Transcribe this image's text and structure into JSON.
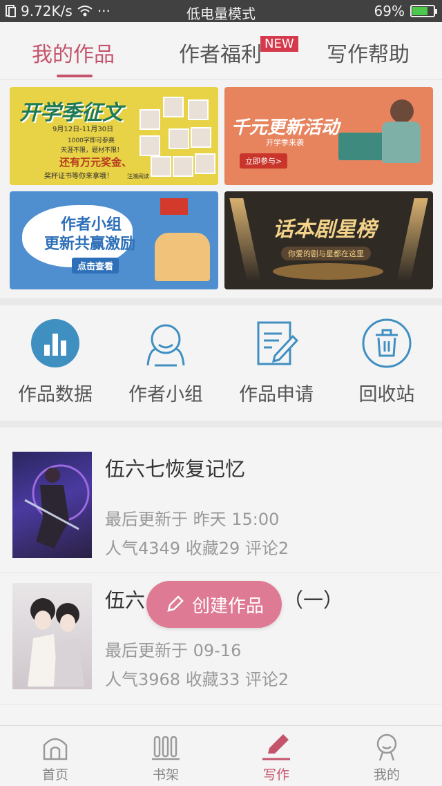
{
  "status_bar": {
    "network_speed": "9.72K/s",
    "more": "···",
    "mode": "低电量模式",
    "battery": "69%",
    "battery_level": 0.69
  },
  "tabs": [
    {
      "label": "我的作品",
      "active": true
    },
    {
      "label": "作者福利",
      "badge": "NEW"
    },
    {
      "label": "写作帮助"
    }
  ],
  "banners": [
    {
      "title": "开学季征文",
      "dates": "9月12日-11月30日",
      "line1": "1000字即可参赛",
      "line2": "天涯不限，题材不限！",
      "line3": "还有万元奖金、",
      "line4": "奖杯证书等你来拿哦！",
      "brand": "汪潮阅读"
    },
    {
      "title": "千元更新活动",
      "subtitle": "开学季来袭",
      "cta": "立即参与>"
    },
    {
      "title1": "作者小组",
      "title2": "更新共赢激励",
      "cta": "点击查看"
    },
    {
      "title": "话本剧星榜",
      "subtitle": "你爱的剧与星都在这里"
    }
  ],
  "quick_actions": [
    {
      "label": "作品数据",
      "icon": "bar-chart-icon"
    },
    {
      "label": "作者小组",
      "icon": "group-icon"
    },
    {
      "label": "作品申请",
      "icon": "edit-document-icon"
    },
    {
      "label": "回收站",
      "icon": "trash-icon"
    }
  ],
  "works": [
    {
      "title": "伍六七恢复记忆",
      "updated": "最后更新于 昨天 15:00",
      "stats": "人气4349 收藏29 评论2"
    },
    {
      "title_start": "伍六",
      "title_end": "（一）",
      "updated": "最后更新于 09-16",
      "stats": "人气3968 收藏33 评论2"
    }
  ],
  "fab": {
    "label": "创建作品",
    "icon": "pencil-icon"
  },
  "bottom_nav": [
    {
      "label": "首页",
      "icon": "home-icon"
    },
    {
      "label": "书架",
      "icon": "bookshelf-icon"
    },
    {
      "label": "写作",
      "icon": "pen-icon",
      "active": true
    },
    {
      "label": "我的",
      "icon": "profile-icon"
    }
  ],
  "colors": {
    "accent": "#c4546c",
    "fab": "#de7a93",
    "badge": "#d53a4c",
    "icon_blue": "#3f8fc0"
  }
}
